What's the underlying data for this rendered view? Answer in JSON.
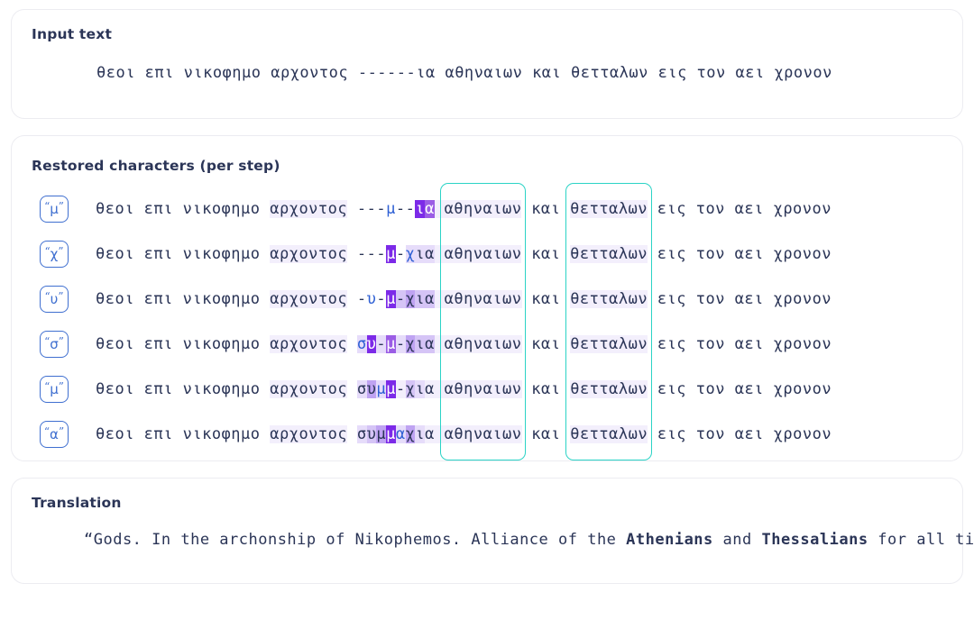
{
  "input_section": {
    "label": "Input text",
    "text": "θεοι επι νικοφημο αρχοντος ------ια αθηναιων και θετταλων εις τον αει χρονον"
  },
  "restored_section": {
    "label": "Restored characters (per step)",
    "highlight_boxes": [
      {
        "name": "athenians",
        "word": "αθηναιων",
        "color": "#2bd3c6"
      },
      {
        "name": "thessalians",
        "word": "θετταλων",
        "color": "#2bd3c6"
      }
    ],
    "colors": {
      "predicted_char": "#2d5fd4",
      "badge_border": "#3f6fd0",
      "highlight_darkest": "#7c2ae8",
      "highlight_mid": "#9b5de5",
      "highlight_light": "#d5c4f6",
      "highlight_faint": "#f3effc",
      "box_border": "#2bd3c6",
      "text": "#2b3557"
    },
    "steps": [
      {
        "badge": "μ",
        "quote_open": "“",
        "quote_close": "”",
        "prefix": "θεοι επι νικοφημο ",
        "prefix_hl": "αρχοντος",
        "gap": "θεοι επι νικοφημο αρχοντος ",
        "segments": [
          {
            "t": "θεοι επι νικοφημο ",
            "hl": 0,
            "pred": false
          },
          {
            "t": "αρχοντος",
            "hl": 1,
            "pred": false
          },
          {
            "t": " ---",
            "hl": 0,
            "pred": false
          },
          {
            "t": "μ",
            "hl": 0,
            "pred": true
          },
          {
            "t": "--",
            "hl": 0,
            "pred": false
          },
          {
            "t": "ι",
            "hl": 6,
            "pred": false
          },
          {
            "t": "α",
            "hl": 5,
            "pred": false
          },
          {
            "t": " ",
            "hl": 1,
            "pred": false
          },
          {
            "t": "αθηναιων",
            "hl": 1,
            "pred": false
          },
          {
            "t": " και ",
            "hl": 0,
            "pred": false
          },
          {
            "t": "θετταλων",
            "hl": 1,
            "pred": false
          },
          {
            "t": " εις τον αει χρονον",
            "hl": 0,
            "pred": false
          }
        ]
      },
      {
        "badge": "χ",
        "quote_open": "“",
        "quote_close": "”",
        "segments": [
          {
            "t": "θεοι επι νικοφημο ",
            "hl": 0,
            "pred": false
          },
          {
            "t": "αρχοντος",
            "hl": 1,
            "pred": false
          },
          {
            "t": " ---",
            "hl": 0,
            "pred": false
          },
          {
            "t": "μ",
            "hl": 6,
            "pred": false
          },
          {
            "t": "-",
            "hl": 0,
            "pred": false
          },
          {
            "t": "χ",
            "hl": 2,
            "pred": true
          },
          {
            "t": "ι",
            "hl": 2,
            "pred": false
          },
          {
            "t": "α",
            "hl": 2,
            "pred": false
          },
          {
            "t": " ",
            "hl": 1,
            "pred": false
          },
          {
            "t": "αθηναιων",
            "hl": 1,
            "pred": false
          },
          {
            "t": " και ",
            "hl": 0,
            "pred": false
          },
          {
            "t": "θετταλων",
            "hl": 1,
            "pred": false
          },
          {
            "t": " εις τον αει χρονον",
            "hl": 0,
            "pred": false
          }
        ]
      },
      {
        "badge": "υ",
        "quote_open": "“",
        "quote_close": "”",
        "segments": [
          {
            "t": "θεοι επι νικοφημο ",
            "hl": 0,
            "pred": false
          },
          {
            "t": "αρχοντος",
            "hl": 1,
            "pred": false
          },
          {
            "t": " -",
            "hl": 0,
            "pred": false
          },
          {
            "t": "υ",
            "hl": 0,
            "pred": true
          },
          {
            "t": "-",
            "hl": 0,
            "pred": false
          },
          {
            "t": "μ",
            "hl": 6,
            "pred": false
          },
          {
            "t": "-",
            "hl": 3,
            "pred": false
          },
          {
            "t": "χ",
            "hl": 4,
            "pred": false
          },
          {
            "t": "ι",
            "hl": 3,
            "pred": false
          },
          {
            "t": "α",
            "hl": 3,
            "pred": false
          },
          {
            "t": " ",
            "hl": 1,
            "pred": false
          },
          {
            "t": "αθηναιων",
            "hl": 1,
            "pred": false
          },
          {
            "t": " και ",
            "hl": 0,
            "pred": false
          },
          {
            "t": "θετταλων",
            "hl": 1,
            "pred": false
          },
          {
            "t": " εις τον αει χρονον",
            "hl": 0,
            "pred": false
          }
        ]
      },
      {
        "badge": "σ",
        "quote_open": "“",
        "quote_close": "”",
        "segments": [
          {
            "t": "θεοι επι νικοφημο ",
            "hl": 0,
            "pred": false
          },
          {
            "t": "αρχοντος",
            "hl": 1,
            "pred": false
          },
          {
            "t": " ",
            "hl": 0,
            "pred": false
          },
          {
            "t": "σ",
            "hl": 2,
            "pred": true
          },
          {
            "t": "υ",
            "hl": 6,
            "pred": false
          },
          {
            "t": "-",
            "hl": 2,
            "pred": false
          },
          {
            "t": "μ",
            "hl": 5,
            "pred": false
          },
          {
            "t": "-",
            "hl": 2,
            "pred": false
          },
          {
            "t": "χ",
            "hl": 4,
            "pred": false
          },
          {
            "t": "ι",
            "hl": 3,
            "pred": false
          },
          {
            "t": "α",
            "hl": 3,
            "pred": false
          },
          {
            "t": " ",
            "hl": 1,
            "pred": false
          },
          {
            "t": "αθηναιων",
            "hl": 1,
            "pred": false
          },
          {
            "t": " και ",
            "hl": 0,
            "pred": false
          },
          {
            "t": "θετταλων",
            "hl": 1,
            "pred": false
          },
          {
            "t": " εις τον αει χρονον",
            "hl": 0,
            "pred": false
          }
        ]
      },
      {
        "badge": "μ",
        "quote_open": "“",
        "quote_close": "”",
        "segments": [
          {
            "t": "θεοι επι νικοφημο ",
            "hl": 0,
            "pred": false
          },
          {
            "t": "αρχοντος",
            "hl": 1,
            "pred": false
          },
          {
            "t": " ",
            "hl": 0,
            "pred": false
          },
          {
            "t": "σ",
            "hl": 2,
            "pred": false
          },
          {
            "t": "υ",
            "hl": 4,
            "pred": false
          },
          {
            "t": "μ",
            "hl": 2,
            "pred": true
          },
          {
            "t": "μ",
            "hl": 6,
            "pred": false
          },
          {
            "t": "-",
            "hl": 1,
            "pred": false
          },
          {
            "t": "χ",
            "hl": 3,
            "pred": false
          },
          {
            "t": "ι",
            "hl": 2,
            "pred": false
          },
          {
            "t": "α",
            "hl": 1,
            "pred": false
          },
          {
            "t": " ",
            "hl": 1,
            "pred": false
          },
          {
            "t": "αθηναιων",
            "hl": 1,
            "pred": false
          },
          {
            "t": " και ",
            "hl": 0,
            "pred": false
          },
          {
            "t": "θετταλων",
            "hl": 1,
            "pred": false
          },
          {
            "t": " εις τον αει χρονον",
            "hl": 0,
            "pred": false
          }
        ]
      },
      {
        "badge": "α",
        "quote_open": "“",
        "quote_close": "”",
        "segments": [
          {
            "t": "θεοι επι νικοφημο ",
            "hl": 0,
            "pred": false
          },
          {
            "t": "αρχοντος",
            "hl": 1,
            "pred": false
          },
          {
            "t": " ",
            "hl": 0,
            "pred": false
          },
          {
            "t": "σ",
            "hl": 2,
            "pred": false
          },
          {
            "t": "υ",
            "hl": 3,
            "pred": false
          },
          {
            "t": "μ",
            "hl": 4,
            "pred": false
          },
          {
            "t": "μ",
            "hl": 6,
            "pred": false
          },
          {
            "t": "α",
            "hl": 2,
            "pred": true
          },
          {
            "t": "χ",
            "hl": 4,
            "pred": false
          },
          {
            "t": "ι",
            "hl": 2,
            "pred": false
          },
          {
            "t": "α",
            "hl": 1,
            "pred": false
          },
          {
            "t": " ",
            "hl": 1,
            "pred": false
          },
          {
            "t": "αθηναιων",
            "hl": 1,
            "pred": false
          },
          {
            "t": " και ",
            "hl": 0,
            "pred": false
          },
          {
            "t": "θετταλων",
            "hl": 1,
            "pred": false
          },
          {
            "t": " εις τον αει χρονον",
            "hl": 0,
            "pred": false
          }
        ]
      }
    ]
  },
  "translation_section": {
    "label": "Translation",
    "parts": [
      {
        "t": "“Gods. In the archonship of Nikophemos. Alliance of the ",
        "bold": false
      },
      {
        "t": "Athenians",
        "bold": true
      },
      {
        "t": " and ",
        "bold": false
      },
      {
        "t": "Thessalians",
        "bold": true
      },
      {
        "t": " for all time”",
        "bold": false
      }
    ]
  }
}
